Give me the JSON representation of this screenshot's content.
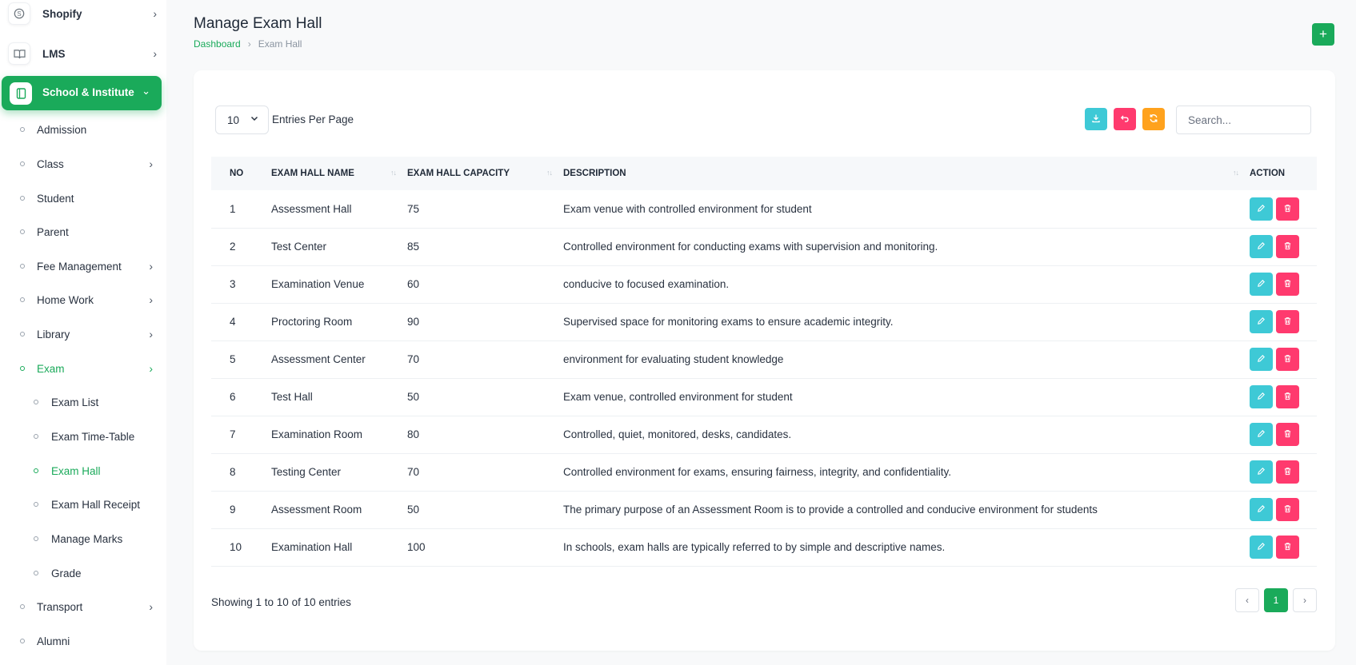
{
  "sidebar": {
    "top_items": [
      {
        "label": "Shopify",
        "icon": "shopify-icon"
      },
      {
        "label": "LMS",
        "icon": "book-icon"
      }
    ],
    "active": {
      "label": "School & Institute",
      "icon": "notebook-icon"
    },
    "items": [
      {
        "label": "Admission"
      },
      {
        "label": "Class"
      },
      {
        "label": "Student"
      },
      {
        "label": "Parent"
      },
      {
        "label": "Fee Management"
      },
      {
        "label": "Home Work"
      },
      {
        "label": "Library"
      },
      {
        "label": "Exam"
      }
    ],
    "exam_items": [
      {
        "label": "Exam List"
      },
      {
        "label": "Exam Time-Table"
      },
      {
        "label": "Exam Hall"
      },
      {
        "label": "Exam Hall Receipt"
      },
      {
        "label": "Manage Marks"
      },
      {
        "label": "Grade"
      }
    ],
    "bottom_items": [
      {
        "label": "Transport"
      },
      {
        "label": "Alumni"
      }
    ]
  },
  "header": {
    "title": "Manage Exam Hall",
    "breadcrumb": {
      "home": "Dashboard",
      "current": "Exam Hall"
    },
    "add_label": "+"
  },
  "toolbar": {
    "entries_value": "10",
    "entries_label": "Entries Per Page",
    "search_placeholder": "Search..."
  },
  "table": {
    "headers": {
      "no": "NO",
      "name": "EXAM HALL NAME",
      "capacity": "EXAM HALL CAPACITY",
      "description": "DESCRIPTION",
      "action": "ACTION"
    },
    "rows": [
      {
        "no": "1",
        "name": "Assessment Hall",
        "capacity": "75",
        "description": "Exam venue with controlled environment for student"
      },
      {
        "no": "2",
        "name": "Test Center",
        "capacity": "85",
        "description": "Controlled environment for conducting exams with supervision and monitoring."
      },
      {
        "no": "3",
        "name": "Examination Venue",
        "capacity": "60",
        "description": "conducive to focused examination."
      },
      {
        "no": "4",
        "name": "Proctoring Room",
        "capacity": "90",
        "description": "Supervised space for monitoring exams to ensure academic integrity."
      },
      {
        "no": "5",
        "name": "Assessment Center",
        "capacity": "70",
        "description": "environment for evaluating student knowledge"
      },
      {
        "no": "6",
        "name": "Test Hall",
        "capacity": "50",
        "description": "Exam venue, controlled environment for student"
      },
      {
        "no": "7",
        "name": "Examination Room",
        "capacity": "80",
        "description": "Controlled, quiet, monitored, desks, candidates."
      },
      {
        "no": "8",
        "name": "Testing Center",
        "capacity": "70",
        "description": "Controlled environment for exams, ensuring fairness, integrity, and confidentiality."
      },
      {
        "no": "9",
        "name": "Assessment Room",
        "capacity": "50",
        "description": "The primary purpose of an Assessment Room is to provide a controlled and conducive environment for students"
      },
      {
        "no": "10",
        "name": "Examination Hall",
        "capacity": "100",
        "description": "In schools, exam halls are typically referred to by simple and descriptive names."
      }
    ]
  },
  "footer": {
    "showing": "Showing 1 to 10 of 10 entries",
    "current_page": "1"
  },
  "colors": {
    "primary": "#1aaa5a",
    "info": "#3ec9d6",
    "danger": "#ff3a6e",
    "warning": "#ffa21d"
  }
}
